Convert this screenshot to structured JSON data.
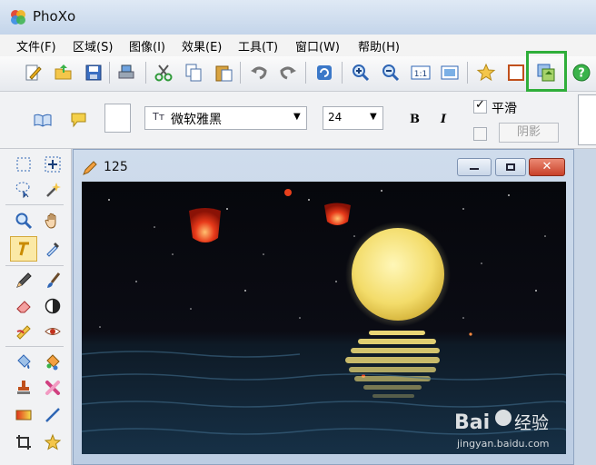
{
  "window": {
    "title": "PhoXo"
  },
  "menu": [
    "文件(F)",
    "区域(S)",
    "图像(I)",
    "效果(E)",
    "工具(T)",
    "窗口(W)",
    "帮助(H)"
  ],
  "toolbar": {
    "icons": [
      "new-icon",
      "open-icon",
      "save-icon",
      "scan-icon",
      "cut-icon",
      "copy-icon",
      "paste-icon",
      "undo-icon",
      "redo-icon",
      "refresh-icon",
      "zoom-in-icon",
      "zoom-out-icon",
      "actual-size-icon",
      "fit-window-icon",
      "favorite-icon",
      "canvas-icon",
      "layer-export-icon",
      "help-icon"
    ],
    "actual_size_label": "1:1",
    "help_label": "?",
    "highlight_color": "#2fae3a"
  },
  "text_options": {
    "font_name": "微软雅黑",
    "font_icon_label": "Tт",
    "font_size": "24",
    "bold_label": "B",
    "italic_label": "I",
    "smooth_label": "平滑",
    "smooth_checked": true,
    "shadow_label": "阴影",
    "shadow_checked": false
  },
  "document": {
    "title": "125"
  },
  "image": {
    "watermark_text": "Bai",
    "watermark_cn": "经验",
    "watermark_url": "jingyan.baidu.com"
  }
}
